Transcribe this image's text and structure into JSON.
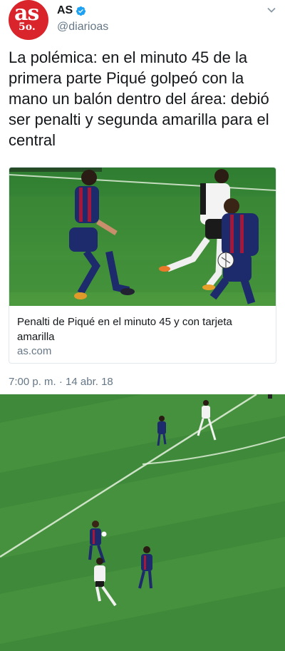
{
  "account": {
    "display_name": "AS",
    "handle": "@diarioas",
    "avatar_text": "as",
    "avatar_sub": "5o."
  },
  "tweet": {
    "text": "La polémica: en el minuto 45 de la primera parte Piqué golpeó con la mano un balón dentro del área: debió ser penalti y segunda amarilla para el central",
    "timestamp": "7:00 p. m. · 14 abr. 18"
  },
  "card": {
    "title": "Penalti de Piqué en el minuto 45 y con tarjeta amarilla",
    "domain": "as.com"
  },
  "icons": {
    "verified": "verified-badge-icon",
    "menu": "chevron-down-icon"
  },
  "colors": {
    "brand_red": "#d9242b",
    "verified_blue": "#1da1f2",
    "pitch_green": "#3f8a3a",
    "secondary_text": "#657786"
  }
}
